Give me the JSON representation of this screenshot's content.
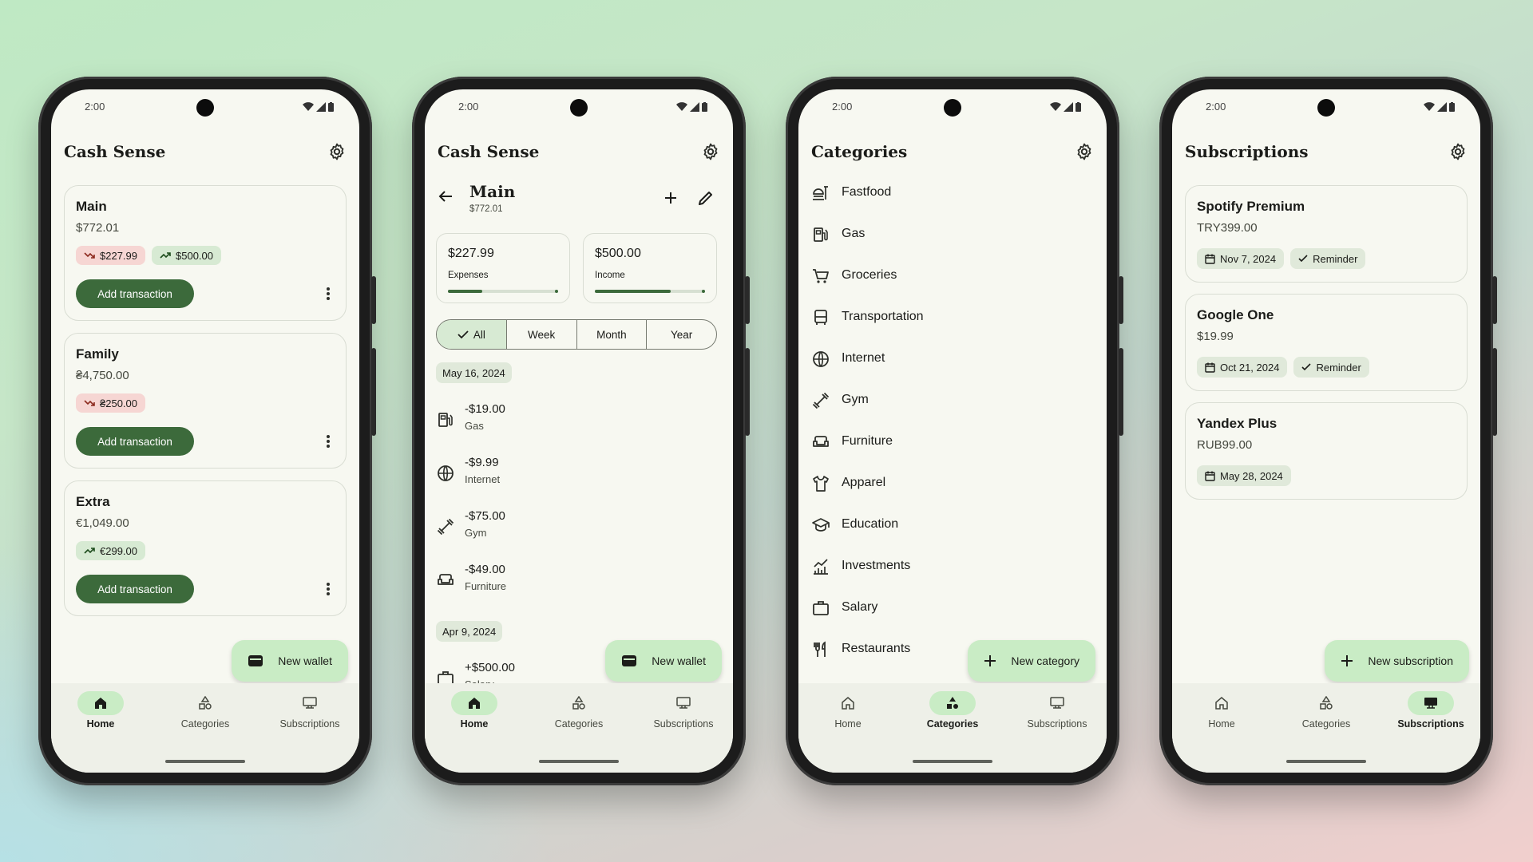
{
  "status": {
    "time": "2:00"
  },
  "app": {
    "title": "Cash Sense"
  },
  "nav": {
    "home": "Home",
    "categories": "Categories",
    "subscriptions": "Subscriptions"
  },
  "phone1": {
    "wallets": [
      {
        "name": "Main",
        "amount": "$772.01",
        "expense": "$227.99",
        "income": "$500.00",
        "action": "Add transaction"
      },
      {
        "name": "Family",
        "amount": "₴4,750.00",
        "expense": "₴250.00",
        "action": "Add transaction"
      },
      {
        "name": "Extra",
        "amount": "€1,049.00",
        "income": "€299.00",
        "action": "Add transaction"
      }
    ],
    "fab": "New wallet"
  },
  "phone2": {
    "wallet_title": "Main",
    "wallet_amount": "$772.01",
    "expenses": {
      "value": "$227.99",
      "label": "Expenses",
      "fill": 0.31
    },
    "income": {
      "value": "$500.00",
      "label": "Income",
      "fill": 0.69
    },
    "filters": [
      "All",
      "Week",
      "Month",
      "Year"
    ],
    "groups": [
      {
        "date": "May 16, 2024",
        "items": [
          {
            "amount": "-$19.00",
            "category": "Gas",
            "icon": "gas-icon"
          },
          {
            "amount": "-$9.99",
            "category": "Internet",
            "icon": "globe-icon"
          },
          {
            "amount": "-$75.00",
            "category": "Gym",
            "icon": "dumbbell-icon"
          },
          {
            "amount": "-$49.00",
            "category": "Furniture",
            "icon": "sofa-icon"
          }
        ]
      },
      {
        "date": "Apr 9, 2024",
        "items": [
          {
            "amount": "+$500.00",
            "category": "Salary",
            "icon": "briefcase-icon"
          }
        ]
      }
    ],
    "fab": "New wallet"
  },
  "phone3": {
    "title": "Categories",
    "categories": [
      "Fastfood",
      "Gas",
      "Groceries",
      "Transportation",
      "Internet",
      "Gym",
      "Furniture",
      "Apparel",
      "Education",
      "Investments",
      "Salary",
      "Restaurants"
    ],
    "fab": "New category"
  },
  "phone4": {
    "title": "Subscriptions",
    "subs": [
      {
        "name": "Spotify Premium",
        "price": "TRY399.00",
        "date": "Nov 7, 2024",
        "reminder": "Reminder"
      },
      {
        "name": "Google One",
        "price": "$19.99",
        "date": "Oct 21, 2024",
        "reminder": "Reminder"
      },
      {
        "name": "Yandex Plus",
        "price": "RUB99.00",
        "date": "May 28, 2024"
      }
    ],
    "fab": "New subscription"
  },
  "colors": {
    "primary": "#3c6a3b",
    "accent_container": "#c9ecc5",
    "expense_chip": "#f6d6d3",
    "income_chip": "#d7ead3",
    "surface": "#f7f8f1"
  }
}
